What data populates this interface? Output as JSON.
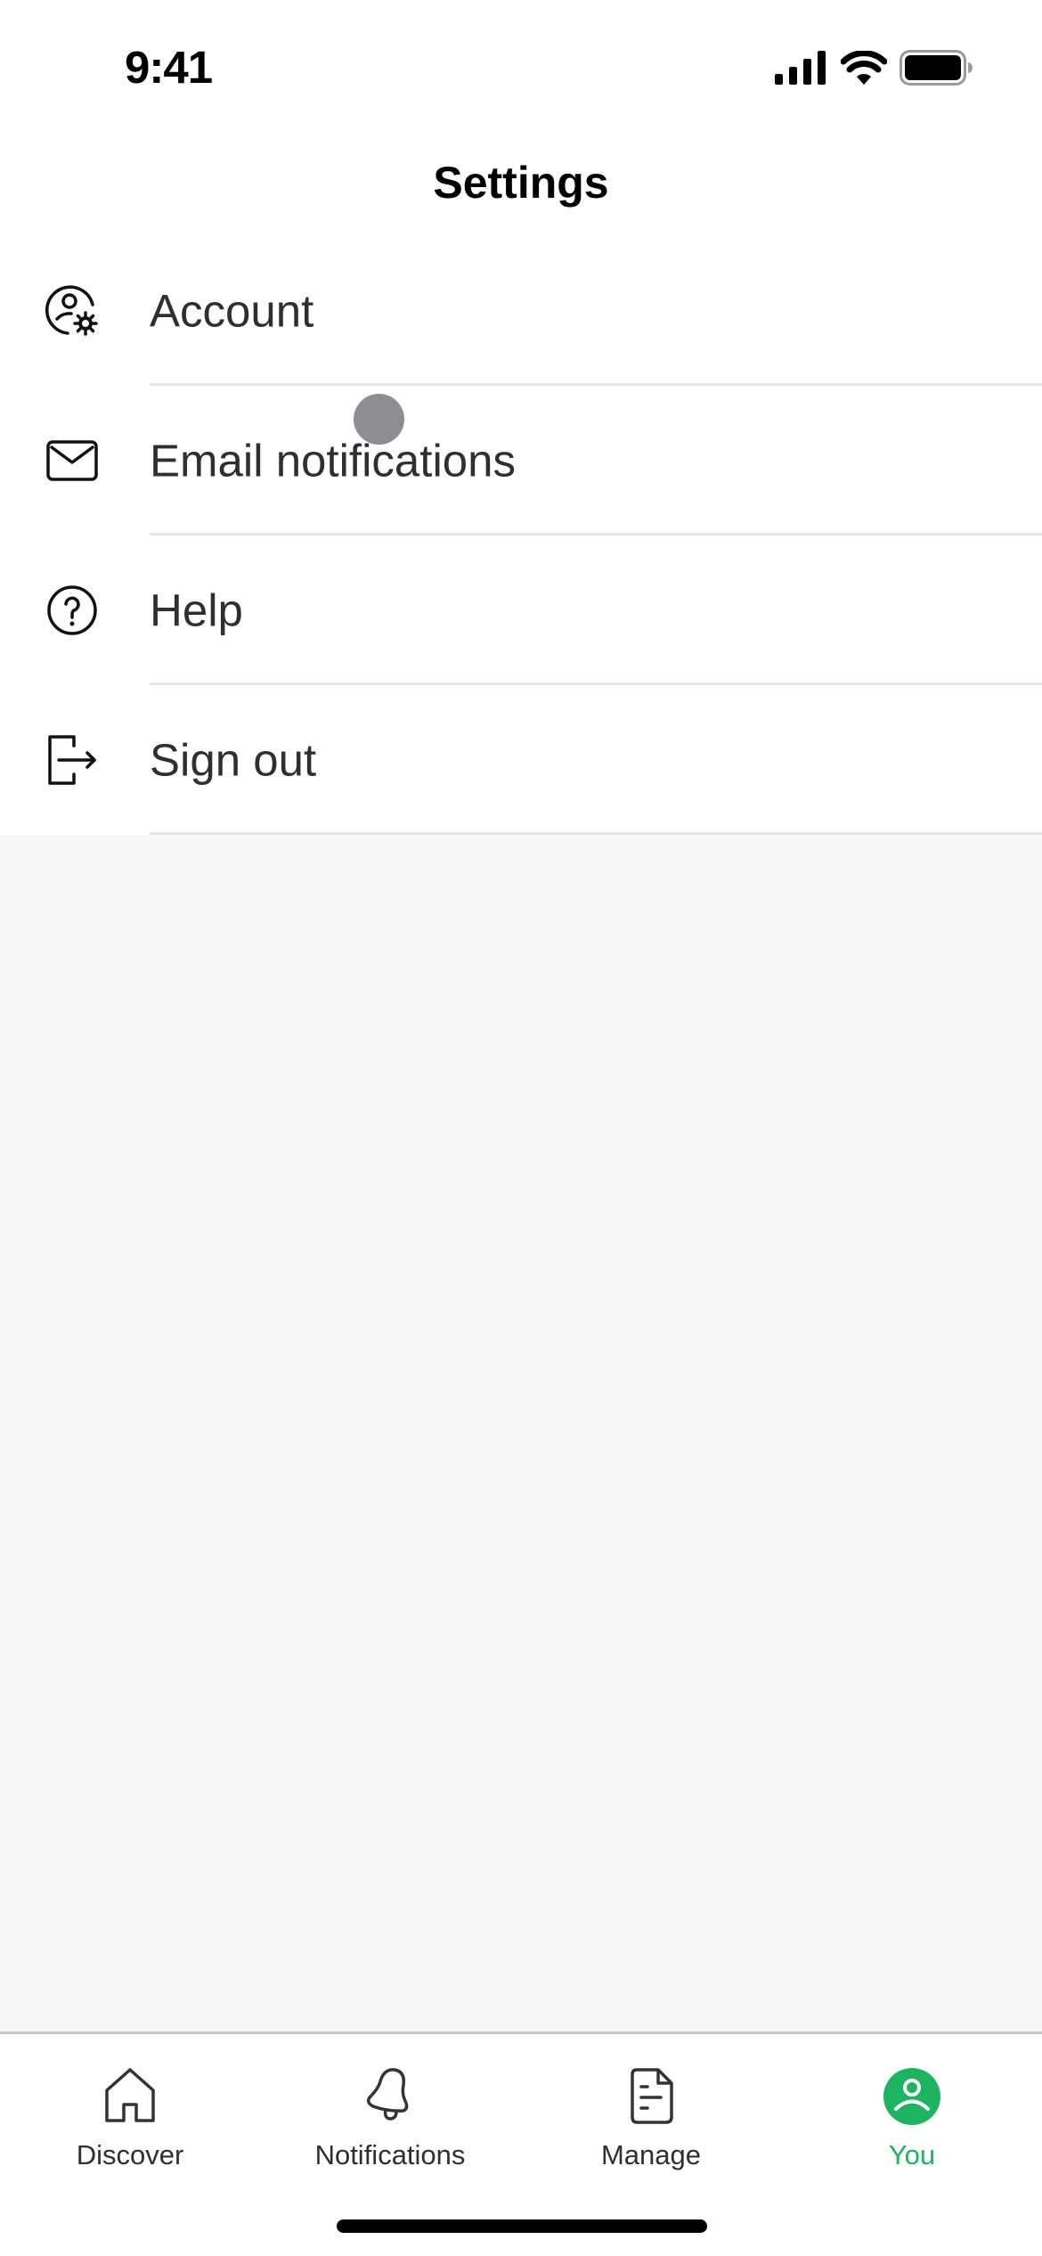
{
  "status_bar": {
    "time": "9:41",
    "icons": [
      "cellular-signal-icon",
      "wifi-icon",
      "battery-icon"
    ]
  },
  "header": {
    "title": "Settings"
  },
  "settings": {
    "items": [
      {
        "label": "Account",
        "icon": "account-settings-icon"
      },
      {
        "label": "Email notifications",
        "icon": "envelope-icon"
      },
      {
        "label": "Help",
        "icon": "question-circle-icon"
      },
      {
        "label": "Sign out",
        "icon": "sign-out-icon"
      }
    ]
  },
  "tab_bar": {
    "active_color": "#1db461",
    "tabs": [
      {
        "label": "Discover",
        "icon": "home-icon",
        "active": false
      },
      {
        "label": "Notifications",
        "icon": "bell-icon",
        "active": false
      },
      {
        "label": "Manage",
        "icon": "document-icon",
        "active": false
      },
      {
        "label": "You",
        "icon": "user-icon",
        "active": true
      }
    ]
  }
}
